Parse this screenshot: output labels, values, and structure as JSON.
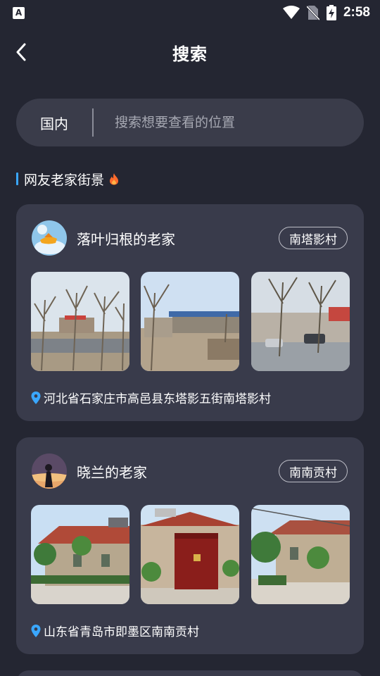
{
  "status_bar": {
    "app_icon": "A",
    "time": "2:58",
    "icons": [
      "wifi-icon",
      "no-sim-icon",
      "battery-charging-icon"
    ]
  },
  "header": {
    "title": "搜索",
    "back_icon": "chevron-left-icon"
  },
  "search": {
    "region": "国内",
    "placeholder": "搜索想要查看的位置"
  },
  "section": {
    "title": "网友老家街景",
    "icon": "fire-icon",
    "accent": "#3aa7ff"
  },
  "cards": [
    {
      "name": "落叶归根的老家",
      "village": "南塔影村",
      "address": "河北省石家庄市高邑县东塔影五街南塔影村"
    },
    {
      "name": "晓兰的老家",
      "village": "南南贡村",
      "address": "山东省青岛市即墨区南南贡村"
    }
  ],
  "colors": {
    "background": "#242632",
    "card": "#393b4b",
    "search_bg": "#3a3c4a",
    "pin": "#3aa7ff",
    "fire": "#ff6b2c"
  }
}
